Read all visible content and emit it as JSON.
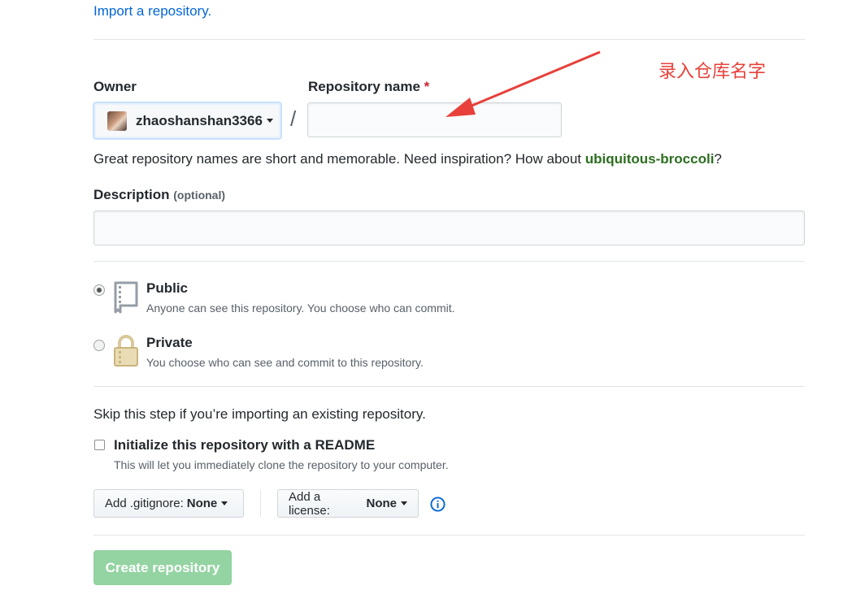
{
  "header": {
    "import_link": "Import a repository."
  },
  "owner": {
    "label": "Owner",
    "name": "zhaoshanshan3366"
  },
  "separator": "/",
  "repo_name": {
    "label": "Repository name",
    "required_mark": "*",
    "value": "",
    "placeholder": ""
  },
  "hint": {
    "prefix": "Great repository names are short and memorable. Need inspiration? How about ",
    "suggestion": "ubiquitous-broccoli",
    "suffix": "?"
  },
  "description": {
    "label": "Description",
    "optional": "(optional)",
    "value": "",
    "placeholder": ""
  },
  "visibility": {
    "public": {
      "title": "Public",
      "desc": "Anyone can see this repository. You choose who can commit.",
      "selected": true
    },
    "private": {
      "title": "Private",
      "desc": "You choose who can see and commit to this repository.",
      "selected": false
    }
  },
  "init": {
    "skip_text": "Skip this step if you’re importing an existing repository.",
    "readme_label": "Initialize this repository with a README",
    "readme_desc": "This will let you immediately clone the repository to your computer.",
    "readme_checked": false
  },
  "gitignore": {
    "prefix": "Add .gitignore:",
    "value": "None"
  },
  "license": {
    "prefix": "Add a license:",
    "value": "None"
  },
  "create_button": "Create repository",
  "annotation": {
    "text": "录入仓库名字",
    "color": "#e8403a"
  },
  "colors": {
    "link": "#0366d6",
    "suggestion": "#2c6e1f",
    "create_button": "#94d3a2",
    "required": "#cb2431"
  },
  "icons": [
    "avatar",
    "caret-down-icon",
    "repo-book-icon",
    "lock-icon",
    "info-icon",
    "arrow-annotation"
  ]
}
